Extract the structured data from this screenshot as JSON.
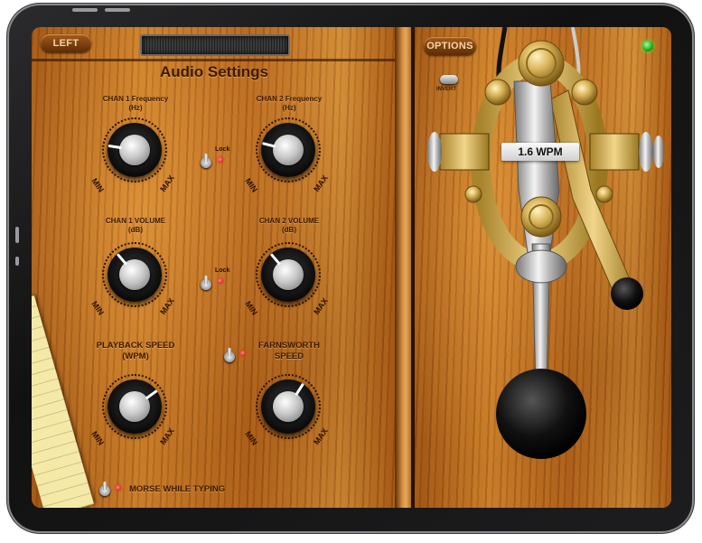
{
  "device": {
    "frame_color": "#1d1d1f"
  },
  "topbar": {
    "left_button": "LEFT"
  },
  "settings": {
    "title": "Audio Settings",
    "chan1_freq": {
      "line1": "CHAN 1 Frequency",
      "line2": "(Hz)"
    },
    "chan2_freq": {
      "line1": "CHAN 2 Frequency",
      "line2": "(Hz)"
    },
    "chan1_vol": {
      "line1": "CHAN 1 VOLUME",
      "line2": "(dB)"
    },
    "chan2_vol": {
      "line1": "CHAN 2 VOLUME",
      "line2": "(dB)"
    },
    "playback": {
      "line1": "PLAYBACK SPEED",
      "line2": "(WPM)"
    },
    "farnsworth": {
      "line1": "FARNSWORTH",
      "line2": "SPEED"
    },
    "lock_label": "Lock",
    "min_label": "MIN",
    "max_label": "MAX",
    "morse_while_typing": "MORSE WHILE TYPING",
    "knob_levels": {
      "chan1_freq": 0.2,
      "chan2_freq": 0.22,
      "chan1_vol": 0.35,
      "chan2_vol": 0.35,
      "playback": 0.7,
      "farnsworth": 0.62
    }
  },
  "key_panel": {
    "options_button": "OPTIONS",
    "invert_label": "INVERT",
    "speed_display": "1.6 WPM",
    "status_led_color": "#18c018"
  },
  "colors": {
    "wood": "#b86a1a",
    "label_text": "#3a1800",
    "led_red": "#d00000"
  }
}
